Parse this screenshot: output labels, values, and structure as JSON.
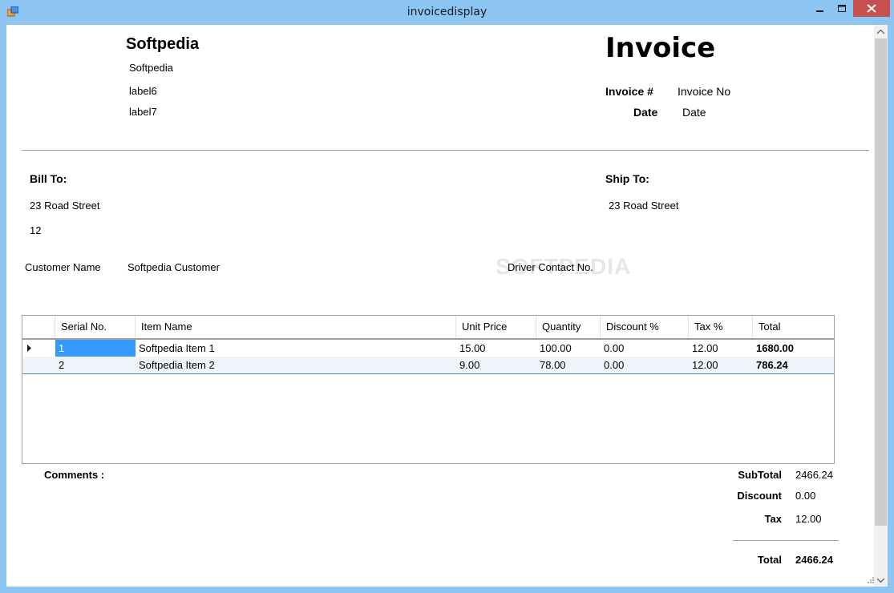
{
  "window": {
    "title": "invoicedisplay"
  },
  "company": {
    "name": "Softpedia",
    "line1": "Softpedia",
    "line2": "label6",
    "line3": "label7"
  },
  "invoice": {
    "heading": "Invoice",
    "number_label": "Invoice #",
    "number_value": "Invoice No",
    "date_label": "Date",
    "date_value": "Date"
  },
  "bill_to": {
    "label": "Bill To:",
    "address": "23 Road Street",
    "line2": "12"
  },
  "ship_to": {
    "label": "Ship To:",
    "address": "23 Road Street"
  },
  "customer": {
    "label": "Customer Name",
    "value": "Softpedia Customer",
    "driver_label": "Driver Contact No."
  },
  "watermark": "SOFTPEDIA",
  "table": {
    "columns": [
      "Serial No.",
      "Item Name",
      "Unit Price",
      "Quantity",
      "Discount %",
      "Tax %",
      "Total"
    ],
    "rows": [
      {
        "serial": "1",
        "item": "Softpedia Item 1",
        "unit_price": "15.00",
        "quantity": "100.00",
        "discount": "0.00",
        "tax": "12.00",
        "total": "1680.00"
      },
      {
        "serial": "2",
        "item": "Softpedia Item 2",
        "unit_price": "9.00",
        "quantity": "78.00",
        "discount": "0.00",
        "tax": "12.00",
        "total": "786.24"
      }
    ]
  },
  "comments": {
    "label": "Comments :"
  },
  "summary": {
    "subtotal_label": "SubTotal",
    "subtotal_value": "2466.24",
    "discount_label": "Discount",
    "discount_value": "0.00",
    "tax_label": "Tax",
    "tax_value": "12.00",
    "total_label": "Total",
    "total_value": "2466.24"
  },
  "icons": {
    "app": "app-icon",
    "minimize": "minimize-icon",
    "maximize": "maximize-icon",
    "close": "close-icon"
  },
  "colors": {
    "titlebar": "#8cc4f2",
    "close": "#c75050",
    "selection": "#3399ff"
  }
}
